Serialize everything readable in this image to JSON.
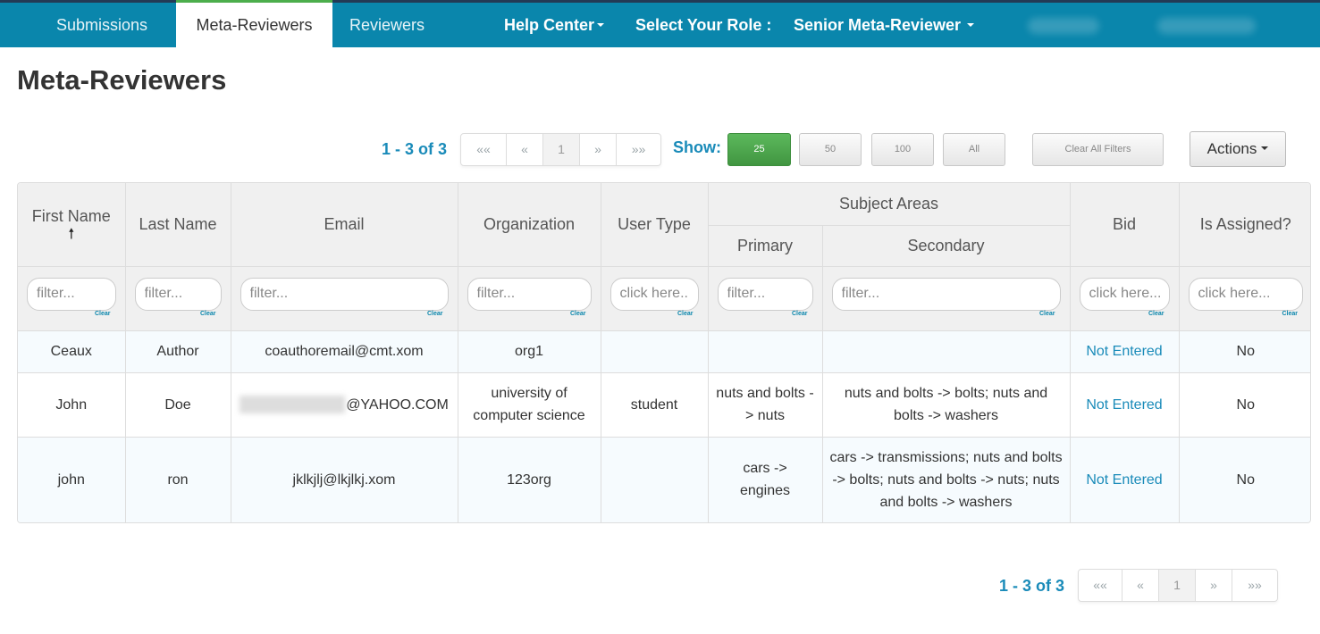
{
  "navbar": {
    "items": [
      {
        "label": "Submissions",
        "active": false
      },
      {
        "label": "Meta-Reviewers",
        "active": true
      },
      {
        "label": "Reviewers",
        "active": false
      }
    ],
    "help_center": "Help Center",
    "role_label": "Select Your Role :",
    "role_value": "Senior Meta-Reviewer"
  },
  "page": {
    "title": "Meta-Reviewers"
  },
  "pager_top": {
    "range": "1 - 3 of 3",
    "first": "««",
    "prev": "«",
    "current": "1",
    "next": "»",
    "last": "»»"
  },
  "page_size": {
    "label": "Show:",
    "options": [
      "25",
      "50",
      "100",
      "All"
    ],
    "selected": "25"
  },
  "toolbar": {
    "clear_filters": "Clear All Filters",
    "actions": "Actions"
  },
  "table": {
    "headers": {
      "first_name": "First Name",
      "last_name": "Last Name",
      "email": "Email",
      "organization": "Organization",
      "user_type": "User Type",
      "subject_areas": "Subject Areas",
      "primary": "Primary",
      "secondary": "Secondary",
      "bid": "Bid",
      "is_assigned": "Is Assigned?"
    },
    "sort_indicator": "🠕",
    "filters": {
      "first_name": "filter...",
      "last_name": "filter...",
      "email": "filter...",
      "organization": "filter...",
      "user_type": "click here...",
      "primary": "filter...",
      "secondary": "filter...",
      "bid": "click here...",
      "is_assigned": "click here..."
    },
    "clear_label": "Clear",
    "rows": [
      {
        "first_name": "Ceaux",
        "last_name": "Author",
        "email": "coauthoremail@cmt.xom",
        "organization": "org1",
        "user_type": "",
        "primary": "",
        "secondary": "",
        "bid": "Not Entered",
        "is_assigned": "No"
      },
      {
        "first_name": "John",
        "last_name": "Doe",
        "email": "@YAHOO.COM",
        "organization": "university of computer science",
        "user_type": "student",
        "primary": "nuts and bolts -> nuts",
        "secondary": "nuts and bolts -> bolts; nuts and bolts -> washers",
        "bid": "Not Entered",
        "is_assigned": "No"
      },
      {
        "first_name": "john",
        "last_name": "ron",
        "email": "jklkjlj@lkjlkj.xom",
        "organization": "123org",
        "user_type": "",
        "primary": "cars -> engines",
        "secondary": "cars -> transmissions; nuts and bolts -> bolts; nuts and bolts -> nuts; nuts and bolts -> washers",
        "bid": "Not Entered",
        "is_assigned": "No"
      }
    ]
  },
  "pager_bottom": {
    "range": "1 - 3 of 3",
    "first": "««",
    "prev": "«",
    "current": "1",
    "next": "»",
    "last": "»»"
  }
}
